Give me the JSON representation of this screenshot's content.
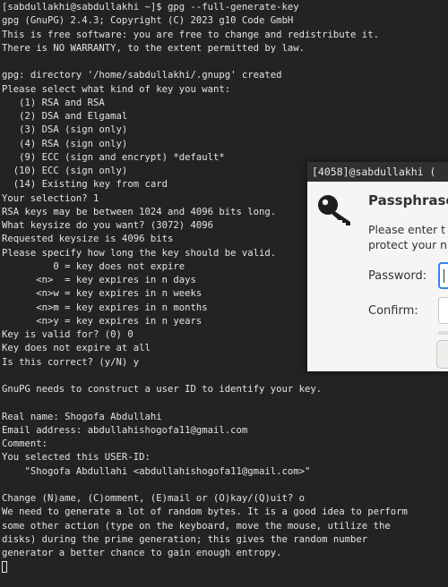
{
  "terminal": {
    "lines": [
      "[sabdullakhi@sabdullakhi ~]$ gpg --full-generate-key",
      "gpg (GnuPG) 2.4.3; Copyright (C) 2023 g10 Code GmbH",
      "This is free software: you are free to change and redistribute it.",
      "There is NO WARRANTY, to the extent permitted by law.",
      "",
      "gpg: directory '/home/sabdullakhi/.gnupg' created",
      "Please select what kind of key you want:",
      "   (1) RSA and RSA",
      "   (2) DSA and Elgamal",
      "   (3) DSA (sign only)",
      "   (4) RSA (sign only)",
      "   (9) ECC (sign and encrypt) *default*",
      "  (10) ECC (sign only)",
      "  (14) Existing key from card",
      "Your selection? 1",
      "RSA keys may be between 1024 and 4096 bits long.",
      "What keysize do you want? (3072) 4096",
      "Requested keysize is 4096 bits",
      "Please specify how long the key should be valid.",
      "         0 = key does not expire",
      "      <n>  = key expires in n days",
      "      <n>w = key expires in n weeks",
      "      <n>m = key expires in n months",
      "      <n>y = key expires in n years",
      "Key is valid for? (0) 0",
      "Key does not expire at all",
      "Is this correct? (y/N) y",
      "",
      "GnuPG needs to construct a user ID to identify your key.",
      "",
      "Real name: Shogofa Abdullahi",
      "Email address: abdullahishogofa11@gmail.com",
      "Comment:",
      "You selected this USER-ID:",
      "    \"Shogofa Abdullahi <abdullahishogofa11@gmail.com>\"",
      "",
      "Change (N)ame, (C)omment, (E)mail or (O)kay/(Q)uit? o",
      "We need to generate a lot of random bytes. It is a good idea to perform",
      "some other action (type on the keyboard, move the mouse, utilize the",
      "disks) during the prime generation; this gives the random number",
      "generator a better chance to gain enough entropy."
    ]
  },
  "pinentry": {
    "title": "[4058]@sabdullakhi (",
    "heading": "Passphrases",
    "description": "Please enter t\nprotect your n",
    "password_label": "Password:",
    "confirm_label": "Confirm:",
    "icon": "key-icon"
  },
  "colors": {
    "terminal_background": "#232323",
    "terminal_text": "#e3e3e3",
    "dialog_background": "#f6f5f4",
    "dialog_titlebar": "#303030",
    "focus_accent": "#3584e4"
  }
}
